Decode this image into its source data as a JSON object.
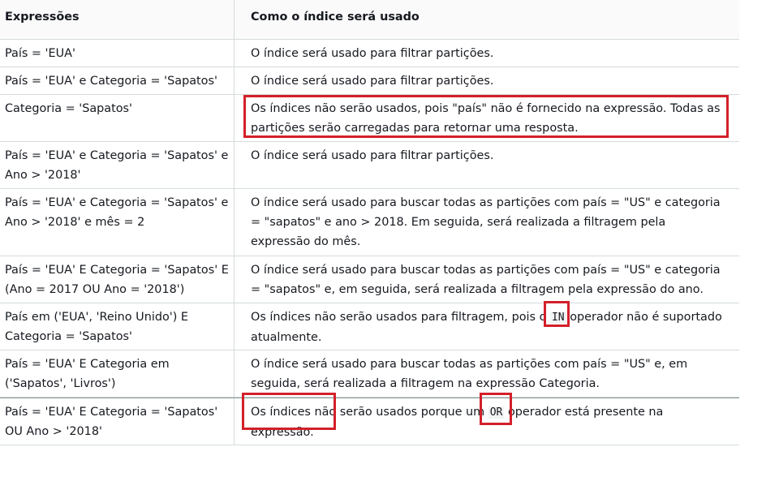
{
  "table": {
    "headers": [
      "Expressões",
      "Como o índice será usado"
    ],
    "rows": [
      {
        "expr": "País = 'EUA'",
        "usage": [
          {
            "t": "O índice será usado para filtrar partições."
          }
        ]
      },
      {
        "expr": "País = 'EUA' e Categoria = 'Sapatos'",
        "usage": [
          {
            "t": "O índice será usado para filtrar partições."
          }
        ]
      },
      {
        "expr": "Categoria = 'Sapatos'",
        "usage": [
          {
            "t": "Os índices não serão usados, pois \"país\" não é fornecido na expressão. Todas as partições serão carregadas para retornar uma resposta."
          }
        ]
      },
      {
        "expr": "País = 'EUA' e Categoria = 'Sapatos' e Ano > '2018'",
        "usage": [
          {
            "t": "O índice será usado para filtrar partições."
          }
        ]
      },
      {
        "expr": "País = 'EUA' e Categoria = 'Sapatos' e Ano > '2018' e mês = 2",
        "usage": [
          {
            "t": "O índice será usado para buscar todas as partições com país = \"US\" e categoria = \"sapatos\" e ano > 2018. Em seguida, será realizada a filtragem pela expressão do mês."
          }
        ]
      },
      {
        "expr": "País = 'EUA' E Categoria = 'Sapatos' E (Ano = 2017 OU Ano = '2018')",
        "usage": [
          {
            "t": "O índice será usado para buscar todas as partições com país = \"US\" e categoria = \"sapatos\" e, em seguida, será realizada a filtragem pela expressão do ano."
          }
        ]
      },
      {
        "expr": "País em ('EUA', 'Reino Unido') E Categoria = 'Sapatos'",
        "usage": [
          {
            "t": "Os índices não serão usados para filtragem, pois o "
          },
          {
            "code": "IN"
          },
          {
            "t": " operador não é suportado atualmente."
          }
        ]
      },
      {
        "expr": "País = 'EUA' E Categoria em ('Sapatos', 'Livros')",
        "usage": [
          {
            "t": "O índice será usado para buscar todas as partições com país = \"US\" e, em seguida, será realizada a filtragem na expressão Categoria."
          }
        ]
      },
      {
        "expr": "País = 'EUA' E Categoria = 'Sapatos' OU Ano > '2018'",
        "usage": [
          {
            "t": "Os índices não serão usados porque um "
          },
          {
            "code": "OR"
          },
          {
            "t": " operador está presente na expressão."
          }
        ]
      }
    ]
  },
  "highlight_color": "#d32029"
}
